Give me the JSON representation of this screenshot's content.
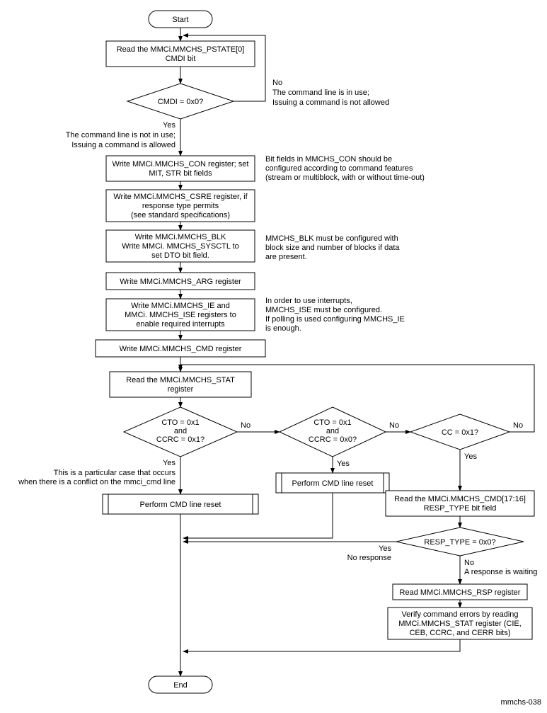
{
  "start": "Start",
  "end": "End",
  "footnote": "mmchs-038",
  "read_pstate_l1": "Read the MMCi.MMCHS_PSTATE[0]",
  "read_pstate_l2": "CMDI bit",
  "dec_cmdi": "CMDI = 0x0?",
  "cmdi_no_label": "No",
  "cmdi_no_l1": "The command line is in use;",
  "cmdi_no_l2": "Issuing a command is not allowed",
  "cmdi_yes_label": "Yes",
  "cmdi_yes_l1": "The command line is not in use;",
  "cmdi_yes_l2": "Issuing a command is allowed",
  "write_con_l1": "Write MMCi.MMCHS_CON register; set",
  "write_con_l2": "MIT, STR bit fields",
  "note_con_l1": "Bit fields in MMCHS_CON should be",
  "note_con_l2": "configured according to command features",
  "note_con_l3": "(stream or multiblock, with or without time-out)",
  "write_csre_l1": "Write MMCi.MMCHS_CSRE register, if",
  "write_csre_l2": "response type permits",
  "write_csre_l3": "(see standard specifications)",
  "write_blk_l1": "Write MMCi.MMCHS_BLK",
  "write_blk_l2": "Write MMCi. MMCHS_SYSCTL to",
  "write_blk_l3": "set DTO bit field.",
  "note_blk_l1": "MMCHS_BLK must be configured with",
  "note_blk_l2": "block size and number of blocks if data",
  "note_blk_l3": "are present.",
  "write_arg": "Write MMCi.MMCHS_ARG register",
  "write_ie_l1": "Write MMCi.MMCHS_IE and",
  "write_ie_l2": "MMCi. MMCHS_ISE registers to",
  "write_ie_l3": "enable required interrupts",
  "note_ie_l1": "In order to use interrupts,",
  "note_ie_l2": "MMCHS_ISE must be configured.",
  "note_ie_l3": "If polling is used configuring MMCHS_IE",
  "note_ie_l4": "is enough.",
  "write_cmd": "Write MMCi.MMCHS_CMD register",
  "read_stat_l1": "Read the MMCi.MMCHS_STAT",
  "read_stat_l2": "register",
  "dec_cto1_l1": "CTO = 0x1",
  "dec_cto1_l2": "and",
  "dec_cto1_l3": "CCRC = 0x1?",
  "dec_cto1_no": "No",
  "dec_cto1_yes": "Yes",
  "note_cto1_l1": "This is a particular case that occurs",
  "note_cto1_l2": "when there is a conflict on the mmci_cmd line",
  "dec_cto0_l1": "CTO = 0x1",
  "dec_cto0_l2": "and",
  "dec_cto0_l3": "CCRC = 0x0?",
  "dec_cto0_no": "No",
  "dec_cto0_yes": "Yes",
  "dec_cc": "CC = 0x1?",
  "dec_cc_no": "No",
  "dec_cc_yes": "Yes",
  "reset1": "Perform CMD line reset",
  "reset2": "Perform CMD line reset",
  "read_resptype_l1": "Read the MMCi.MMCHS_CMD[17:16]",
  "read_resptype_l2": "RESP_TYPE bit field",
  "dec_resp": "RESP_TYPE =  0x0?",
  "dec_resp_yes": "Yes",
  "dec_resp_yes_sub": "No response",
  "dec_resp_no": "No",
  "dec_resp_no_sub": "A response is waiting",
  "read_rsp": "Read MMCi.MMCHS_RSP register",
  "verify_l1": "Verify command errors by reading",
  "verify_l2": "MMCi.MMCHS_STAT register (CIE,",
  "verify_l3": "CEB, CCRC, and CERR bits)"
}
